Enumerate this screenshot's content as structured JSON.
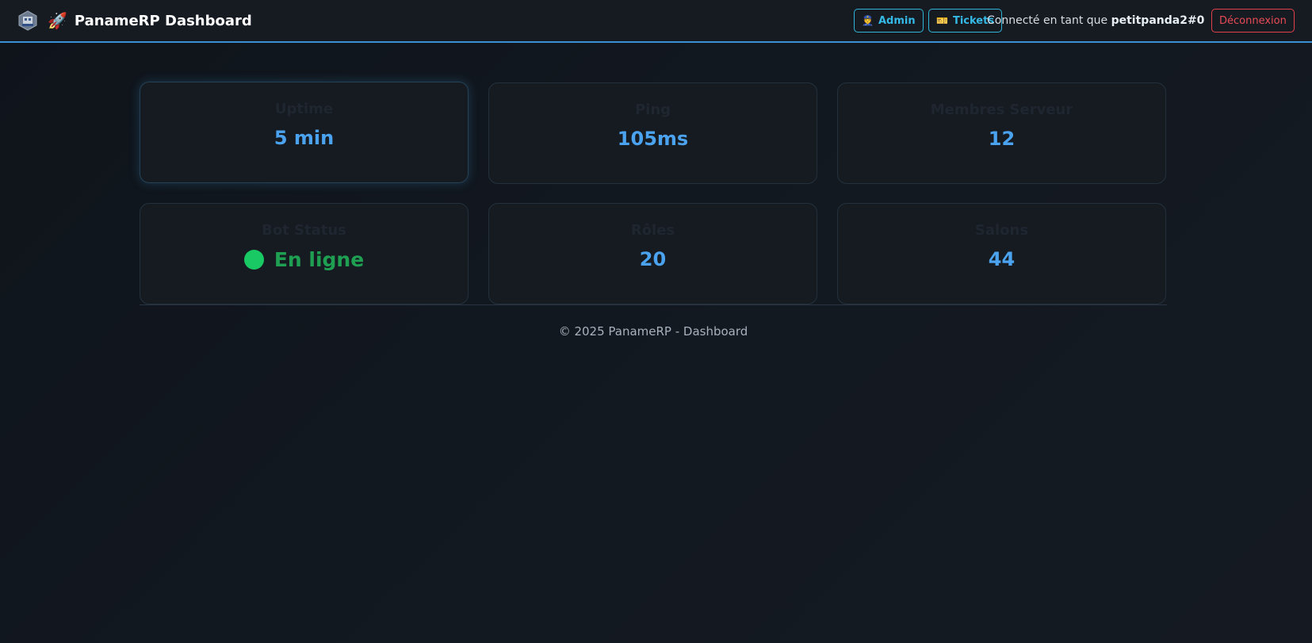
{
  "header": {
    "title": "PanameRP Dashboard",
    "rocket_emoji": "🚀",
    "admin_icon": "👮",
    "admin_label": "Admin",
    "tickets_icon": "🎫",
    "tickets_label": "Tickets",
    "connected_prefix": "Connecté en tant que",
    "username": "petitpanda2#0",
    "logout_label": "Déconnexion"
  },
  "stats": [
    {
      "label": "Uptime",
      "value": "5 min"
    },
    {
      "label": "Ping",
      "value": "105ms"
    },
    {
      "label": "Membres Serveur",
      "value": "12"
    },
    {
      "label": "Bot Status",
      "value": "En ligne"
    },
    {
      "label": "Rôles",
      "value": "20"
    },
    {
      "label": "Salons",
      "value": "44"
    }
  ],
  "footer": {
    "text": "© 2025 PanameRP - Dashboard"
  },
  "colors": {
    "accent": "#4ba3f0",
    "online": "#18c964",
    "logout": "#ea4a55",
    "nav_button": "#35b9e6"
  },
  "icons": {
    "logo": "server-logo-icon",
    "rocket": "rocket-icon",
    "admin": "police-officer-icon",
    "tickets": "ticket-icon",
    "status": "online-dot-icon"
  }
}
